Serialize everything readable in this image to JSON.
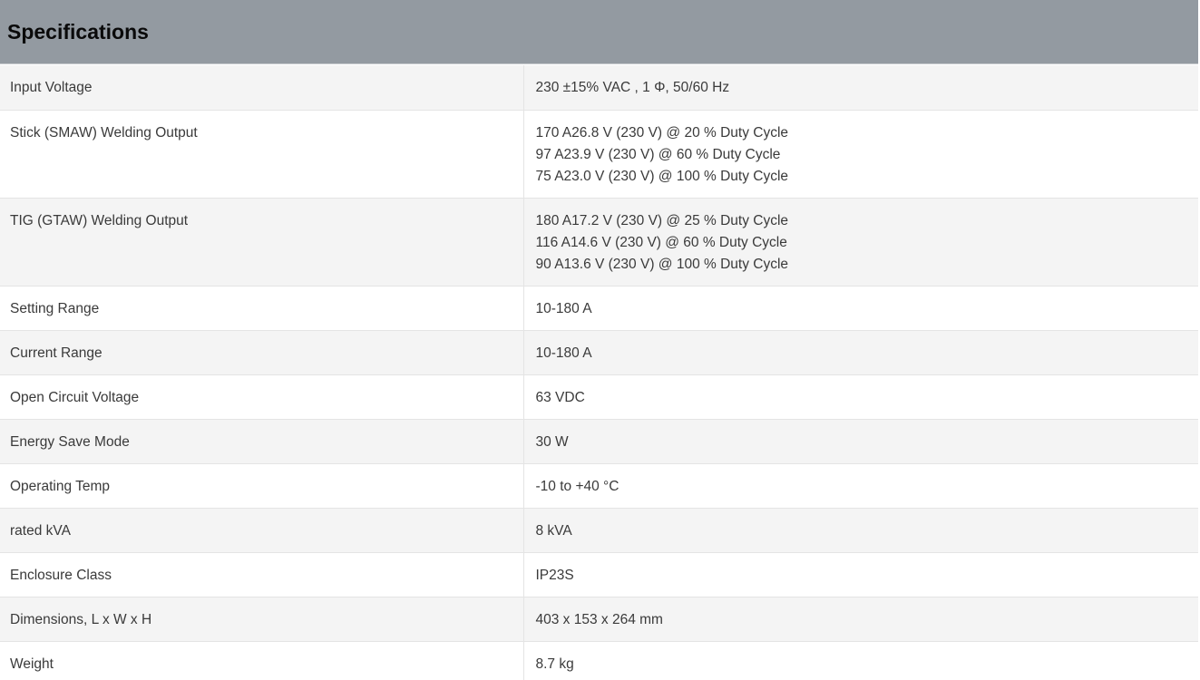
{
  "section": {
    "title": "Specifications"
  },
  "specs": [
    {
      "label": "Input Voltage",
      "values": [
        "230 ±15% VAC , 1 Φ, 50/60 Hz"
      ]
    },
    {
      "label": "Stick (SMAW) Welding Output",
      "values": [
        "170 A26.8 V (230 V) @ 20 % Duty Cycle",
        "97 A23.9 V (230 V) @ 60 % Duty Cycle",
        "75 A23.0 V (230 V) @ 100 % Duty Cycle"
      ]
    },
    {
      "label": "TIG (GTAW) Welding Output",
      "values": [
        "180 A17.2 V (230 V) @ 25 % Duty Cycle",
        "116 A14.6 V (230 V) @ 60 % Duty Cycle",
        "90 A13.6 V (230 V) @ 100 % Duty Cycle"
      ]
    },
    {
      "label": "Setting Range",
      "values": [
        "10-180 A"
      ]
    },
    {
      "label": "Current Range",
      "values": [
        "10-180 A"
      ]
    },
    {
      "label": "Open Circuit Voltage",
      "values": [
        "63 VDC"
      ]
    },
    {
      "label": "Energy Save Mode",
      "values": [
        "30 W"
      ]
    },
    {
      "label": "Operating Temp",
      "values": [
        "-10 to +40 °C"
      ]
    },
    {
      "label": "rated kVA",
      "values": [
        "8 kVA"
      ]
    },
    {
      "label": "Enclosure Class",
      "values": [
        "IP23S"
      ]
    },
    {
      "label": "Dimensions, L x W x H",
      "values": [
        "403 x 153 x 264 mm"
      ]
    },
    {
      "label": "Weight",
      "values": [
        "8.7 kg"
      ]
    }
  ]
}
